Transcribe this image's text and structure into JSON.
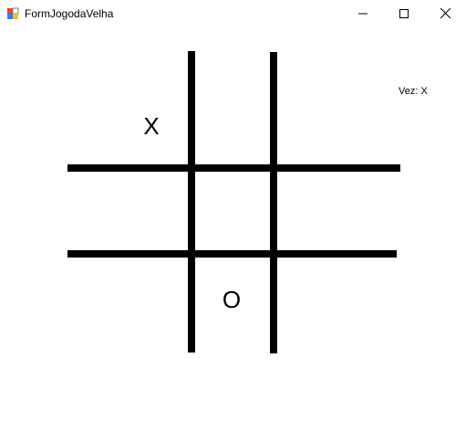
{
  "window": {
    "title": "FormJogodaVelha",
    "app_icon": "form-app-icon",
    "controls": {
      "minimize_icon": "minimize-icon",
      "maximize_icon": "maximize-icon",
      "close_icon": "close-icon"
    }
  },
  "board": {
    "line_color": "#000000",
    "cells": {
      "r0c0": "X",
      "r2c1": "O"
    }
  },
  "status": {
    "turn_text": "Vez: X"
  }
}
